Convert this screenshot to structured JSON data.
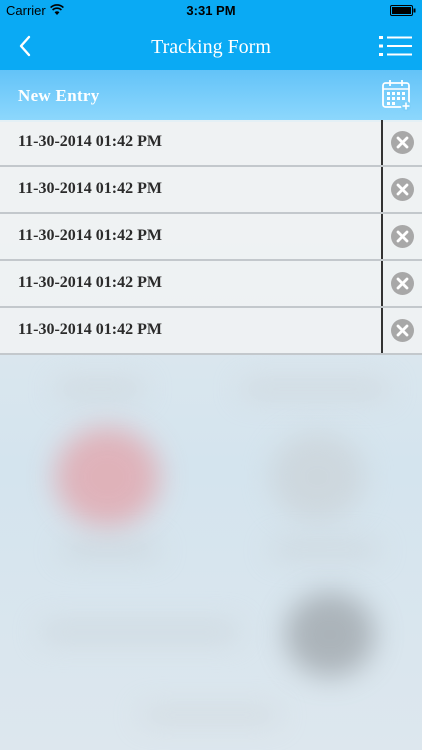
{
  "status_bar": {
    "carrier": "Carrier",
    "time": "3:31 PM"
  },
  "nav": {
    "title": "Tracking Form",
    "back_icon": "chevron-left-icon",
    "menu_icon": "list-icon"
  },
  "new_entry": {
    "label": "New Entry",
    "icon": "calendar-add-icon"
  },
  "entries": [
    {
      "datetime": "11-30-2014 01:42 PM"
    },
    {
      "datetime": "11-30-2014 01:42 PM"
    },
    {
      "datetime": "11-30-2014 01:42 PM"
    },
    {
      "datetime": "11-30-2014 01:42 PM"
    },
    {
      "datetime": "11-30-2014 01:42 PM"
    }
  ],
  "colors": {
    "accent": "#0aaaf4",
    "entry_bar": "#7ccff9",
    "delete_icon": "#a8a8a8"
  }
}
